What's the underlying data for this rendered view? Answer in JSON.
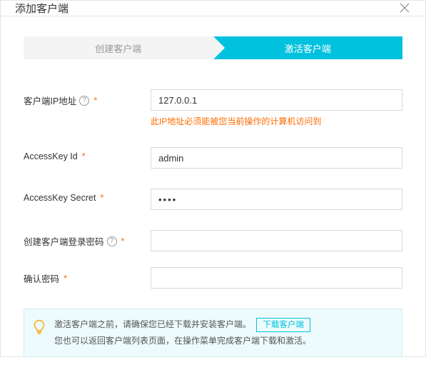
{
  "dialog": {
    "title": "添加客户端"
  },
  "steps": {
    "create": "创建客户端",
    "activate": "激活客户端"
  },
  "fields": {
    "ip": {
      "label": "客户端IP地址",
      "value": "127.0.0.1",
      "hint": "此IP地址必须能被您当前操作的计算机访问到"
    },
    "ak_id": {
      "label": "AccessKey Id",
      "value": "admin"
    },
    "ak_secret": {
      "label": "AccessKey Secret",
      "value": "••••"
    },
    "login_pw": {
      "label": "创建客户端登录密码",
      "value": ""
    },
    "confirm_pw": {
      "label": "确认密码",
      "value": ""
    }
  },
  "info": {
    "line1": "激活客户端之前，请确保您已经下载并安装客户端。",
    "download_label": "下载客户端",
    "line2": "您也可以返回客户端列表页面，在操作菜单完成客户端下载和激活。"
  },
  "symbols": {
    "required": "*",
    "help": "?"
  }
}
